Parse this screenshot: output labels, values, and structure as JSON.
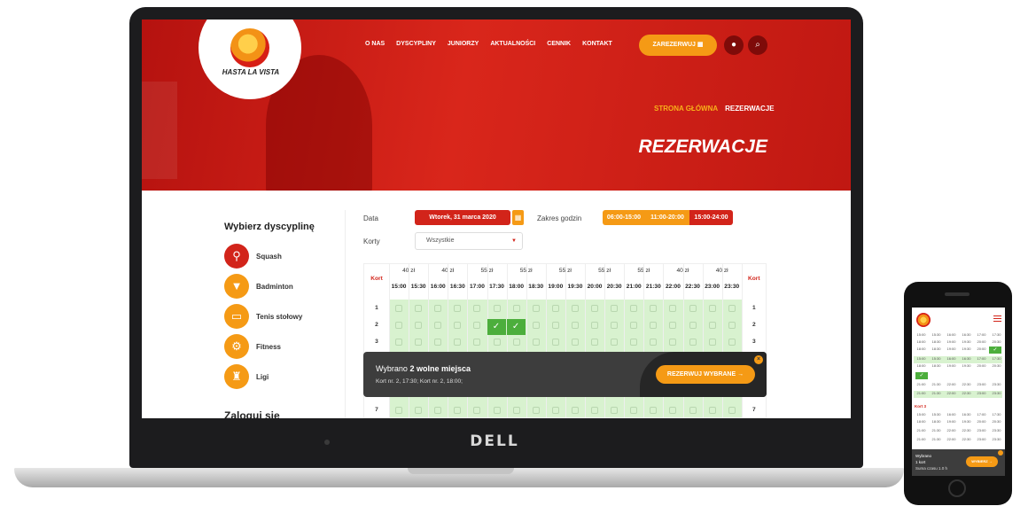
{
  "brand": {
    "logo_text": "HASTA LA VISTA",
    "primary": "#d2241a",
    "accent": "#f59a15",
    "selected": "#4cae3c",
    "available": "#d8f2cf"
  },
  "device_label": "DELL",
  "nav": {
    "items": [
      "O NAS",
      "DYSCYPLINY",
      "JUNIORZY",
      "AKTUALNOŚCI",
      "CENNIK",
      "KONTAKT"
    ],
    "reserve_button": "ZAREZERWUJ",
    "icons": [
      "user-icon",
      "search-icon"
    ]
  },
  "breadcrumb": {
    "home": "STRONA GŁÓWNA",
    "current": "REZERWACJE"
  },
  "page_title": "REZERWACJE",
  "sidebar": {
    "title": "Wybierz dyscyplinę",
    "sports": [
      {
        "label": "Squash",
        "icon": "squash-racket-icon",
        "active": true
      },
      {
        "label": "Badminton",
        "icon": "shuttlecock-icon",
        "active": false
      },
      {
        "label": "Tenis stołowy",
        "icon": "ping-pong-table-icon",
        "active": false
      },
      {
        "label": "Fitness",
        "icon": "exercise-bike-icon",
        "active": false
      },
      {
        "label": "Ligi",
        "icon": "trophy-icon",
        "active": false
      }
    ],
    "login_title": "Zaloguj się"
  },
  "filters": {
    "date_label": "Data",
    "date_value": "Wtorek, 31 marca 2020",
    "hours_label": "Zakres godzin",
    "hour_ranges": [
      "06:00-15:00",
      "11:00-20:00",
      "15:00-24:00"
    ],
    "active_range": 2,
    "courts_label": "Korty",
    "courts_value": "Wszystkie"
  },
  "schedule": {
    "court_header": "Kort",
    "prices": [
      "40 zł",
      "40 zł",
      "55 zł",
      "55 zł",
      "55 zł",
      "55 zł",
      "55 zł",
      "40 zł",
      "40 zł"
    ],
    "times": [
      "15:00",
      "15:30",
      "16:00",
      "16:30",
      "17:00",
      "17:30",
      "18:00",
      "18:30",
      "19:00",
      "19:30",
      "20:00",
      "20:30",
      "21:00",
      "21:30",
      "22:00",
      "22:30",
      "23:00",
      "23:30"
    ],
    "courts": [
      "1",
      "2",
      "3",
      "7"
    ],
    "selected": [
      {
        "court": "2",
        "time": "17:30"
      },
      {
        "court": "2",
        "time": "18:00"
      }
    ]
  },
  "selection_popup": {
    "prefix": "Wybrano ",
    "count_text": "2 wolne miejsca",
    "details": "Kort nr. 2, 17:30; Kort nr. 2, 18:00;",
    "button": "REZERWUJ WYBRANE →"
  },
  "mobile": {
    "kort_label": "Kort 3",
    "popup_line1": "Wybrano",
    "popup_line2": "1 kort",
    "popup_line3": "Suma czasu 1.0 h",
    "popup_button": "WYBIERZ →"
  }
}
